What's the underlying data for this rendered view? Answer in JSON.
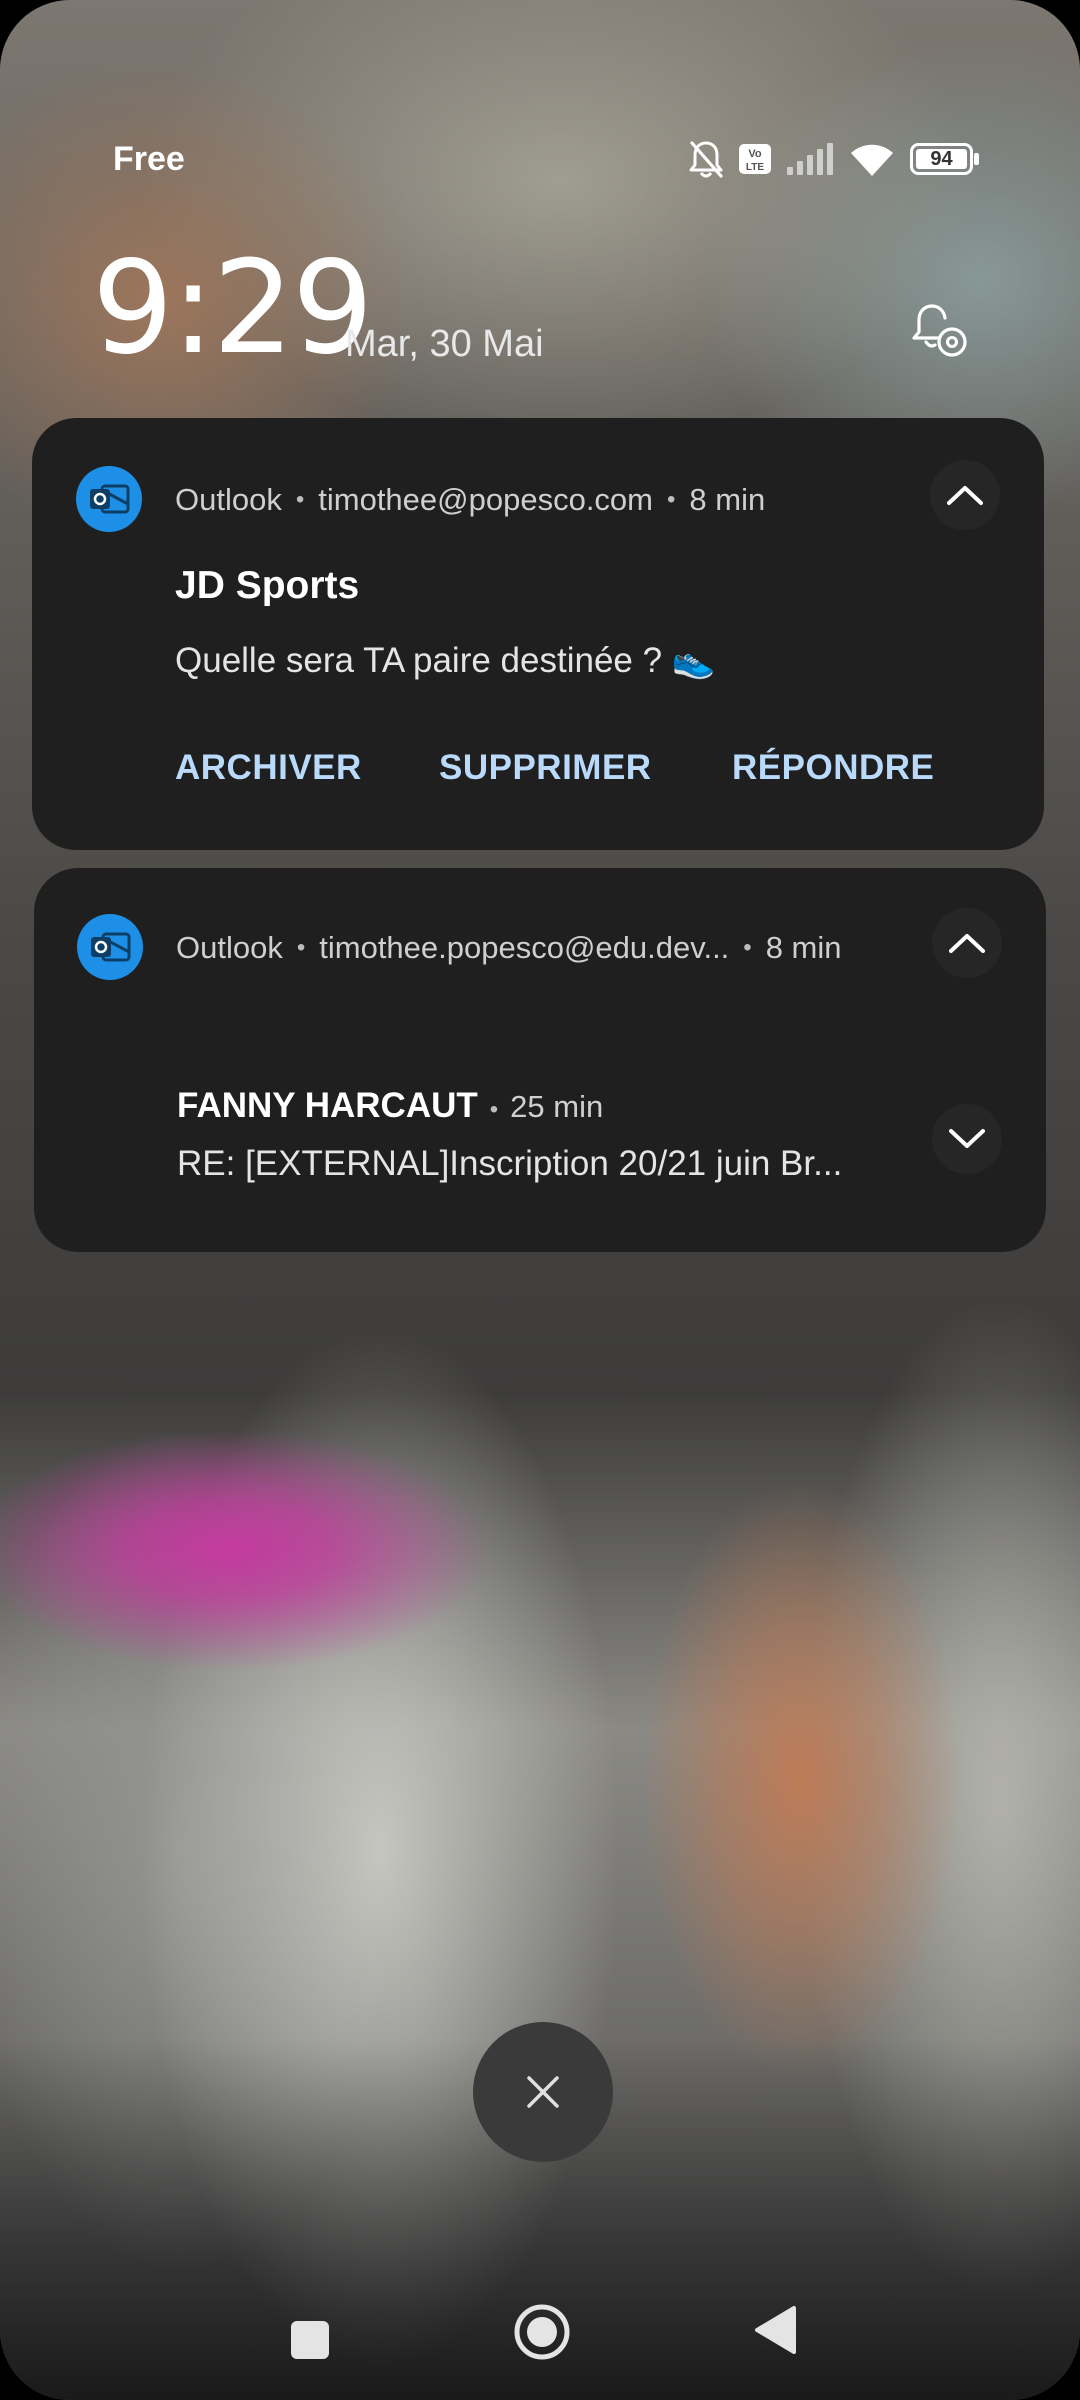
{
  "status_bar": {
    "carrier": "Free",
    "battery": "94",
    "icons": [
      "bell-muted-icon",
      "volte-icon",
      "signal-icon",
      "wifi-icon",
      "battery-icon"
    ]
  },
  "lockscreen": {
    "time": "9:29",
    "date": "Mar, 30 Mai",
    "settings_icon": "bell-settings-icon"
  },
  "notifications": [
    {
      "app": "Outlook",
      "account": "timothee@popesco.com",
      "time": "8 min",
      "title": "JD Sports",
      "body": "Quelle sera TA paire destinée ? 👟",
      "actions": [
        "ARCHIVER",
        "SUPPRIMER",
        "RÉPONDRE"
      ]
    },
    {
      "app": "Outlook",
      "account": "timothee.popesco@edu.dev...",
      "time": "8 min",
      "sender": "FANNY HARCAUT",
      "sender_time": "25 min",
      "preview": "RE: [EXTERNAL]Inscription 20/21 juin Br..."
    }
  ],
  "controls": {
    "clear_all_icon": "close-icon",
    "nav": [
      "recents-icon",
      "home-icon",
      "back-icon"
    ]
  },
  "colors": {
    "card_background": "#1f1f1f",
    "outlook_blue": "#1e8fe6",
    "action_text": "#b9dafb"
  }
}
